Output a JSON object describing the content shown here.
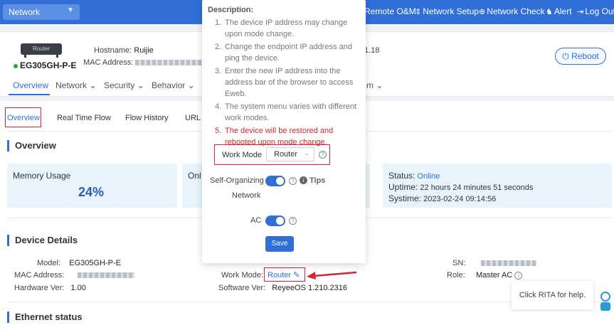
{
  "topbar": {
    "network_select": "Network",
    "nav": [
      "Remote O&M",
      "Network Setup",
      "Network Check",
      "Alert",
      "Log Out"
    ]
  },
  "device": {
    "image_label": "Router",
    "model": "EG305GH-P-E",
    "hostname_label": "Hostname:",
    "hostname_value": "Ruijie",
    "mac_label": "MAC Address:",
    "version_fragment": "1.18",
    "reboot_label": "Reboot"
  },
  "mainnav": [
    "Overview",
    "Network",
    "Security",
    "Behavior",
    "m"
  ],
  "subtabs": [
    "Overview",
    "Real Time Flow",
    "Flow History",
    "URL L"
  ],
  "overview": {
    "title": "Overview",
    "memory_label": "Memory Usage",
    "memory_value": "24%",
    "online_fragment": "Onl",
    "status_label": "Status:",
    "status_value": "Online",
    "uptime_label": "Uptime:",
    "uptime_value": "22 hours 24 minutes 51 seconds",
    "systime_label": "Systime:",
    "systime_value": "2023-02-24 09:14:56"
  },
  "details": {
    "title": "Device Details",
    "model_label": "Model:",
    "model_value": "EG305GH-P-E",
    "mac_label": "MAC Address:",
    "hw_label": "Hardware Ver:",
    "hw_value": "1.00",
    "workmode_label": "Work Mode:",
    "workmode_value": "Router",
    "sw_label": "Software Ver:",
    "sw_value": "ReyeeOS 1.210.2316",
    "sn_label": "SN:",
    "role_label": "Role:",
    "role_value": "Master AC"
  },
  "ethernet": {
    "title": "Ethernet status"
  },
  "popup": {
    "title": "Description:",
    "items": [
      "The device IP address may change upon mode change.",
      "Change the endpoint IP address and ping the device.",
      "Enter the new IP address into the address bar of the browser to access Eweb.",
      "The system menu varies with different work modes.",
      "The device will be restored and rebooted upon mode change."
    ],
    "workmode_label": "Work Mode",
    "workmode_value": "Router",
    "self_org_label": "Self-Organizing",
    "self_org_label2": "Network",
    "tips_label": "Tips",
    "ac_label": "AC",
    "save_label": "Save"
  },
  "rita": {
    "text": "Click RITA for help."
  }
}
